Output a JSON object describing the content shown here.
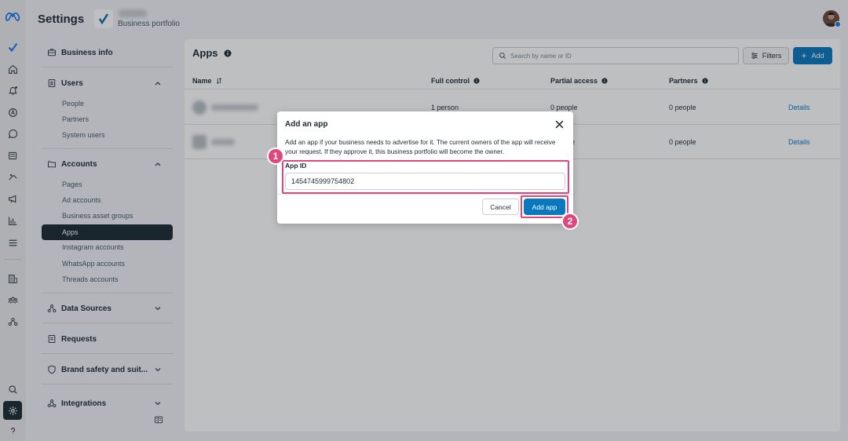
{
  "header": {
    "title": "Settings",
    "portfolio_sub": "Business portfolio"
  },
  "sidebar": {
    "business_info": "Business info",
    "users": {
      "label": "Users",
      "items": [
        "People",
        "Partners",
        "System users"
      ]
    },
    "accounts": {
      "label": "Accounts",
      "items": [
        "Pages",
        "Ad accounts",
        "Business asset groups",
        "Apps",
        "Instagram accounts",
        "WhatsApp accounts",
        "Threads accounts"
      ],
      "active": "Apps"
    },
    "data_sources": "Data Sources",
    "requests": "Requests",
    "brand_safety": "Brand safety and suit...",
    "integrations": "Integrations"
  },
  "main": {
    "title": "Apps",
    "search_placeholder": "Search by name or ID",
    "filters_label": "Filters",
    "add_label": "Add",
    "columns": [
      "Name",
      "Full control",
      "Partial access",
      "Partners"
    ],
    "rows": [
      {
        "full_control": "1 person",
        "partial_access": "0 people",
        "partners": "0 people",
        "action": "Details"
      },
      {
        "full_control": "",
        "partial_access": "e",
        "partners": "0 people",
        "action": "Details"
      }
    ]
  },
  "modal": {
    "title": "Add an app",
    "description": "Add an app if your business needs to advertise for it. The current owners of the app will receive your request. If they approve it, this business portfolio will become the owner.",
    "field_label": "App ID",
    "field_value": "1454745999754802",
    "cancel_label": "Cancel",
    "confirm_label": "Add app"
  },
  "annotations": {
    "step1": "1",
    "step2": "2",
    "highlight_color": "#e0457b"
  },
  "colors": {
    "primary": "#0a78be",
    "sidebar_active": "#1c2b33"
  }
}
